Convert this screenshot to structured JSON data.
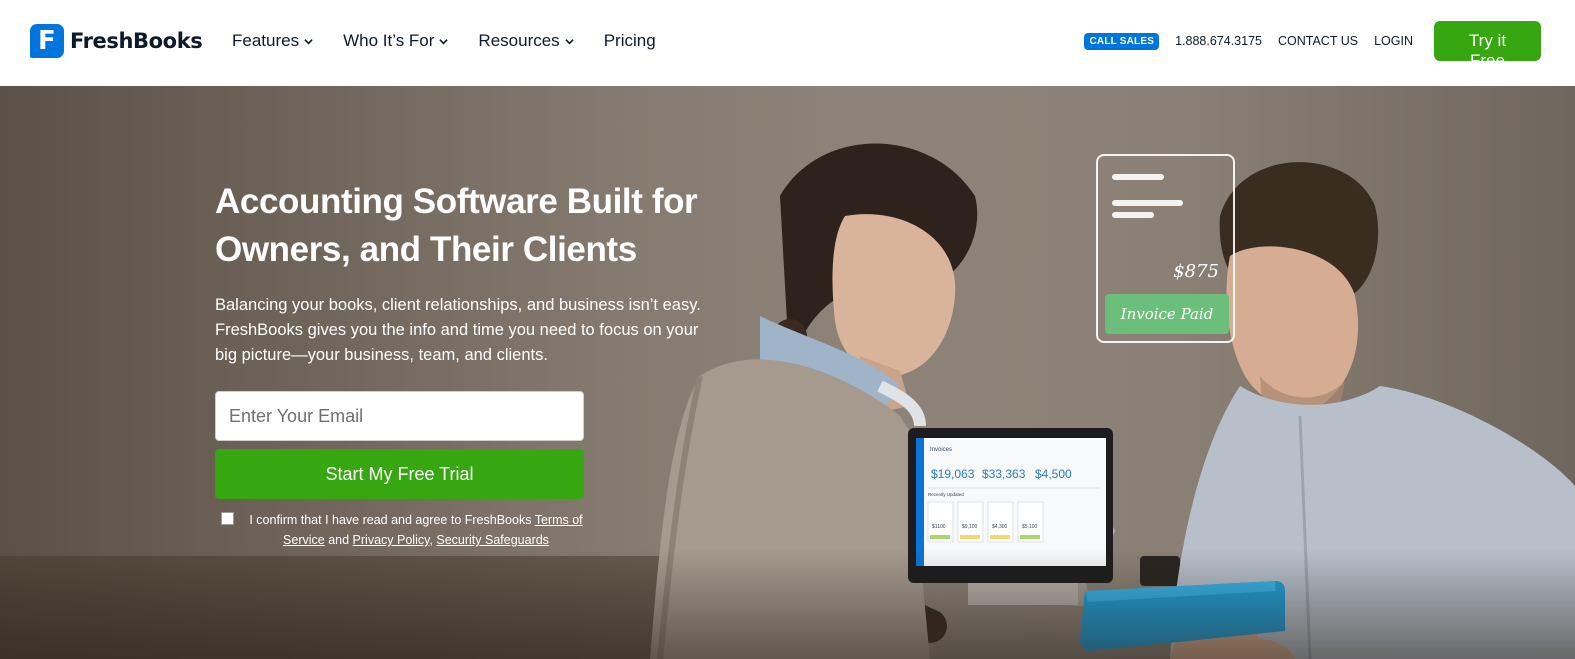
{
  "brand": {
    "name": "FreshBooks",
    "logo_letter": "F"
  },
  "nav": {
    "items": [
      {
        "label": "Features",
        "has_dropdown": true
      },
      {
        "label": "Who It’s For",
        "has_dropdown": true
      },
      {
        "label": "Resources",
        "has_dropdown": true
      },
      {
        "label": "Pricing",
        "has_dropdown": false
      }
    ]
  },
  "header_right": {
    "call_sales": "CALL SALES",
    "phone": "1.888.674.3175",
    "contact": "CONTACT US",
    "login": "LOGIN",
    "try_free": "Try it Free"
  },
  "hero": {
    "title": "Accounting Software Built for Owners, and Their Clients",
    "subtitle": "Balancing your books, client relationships, and business isn’t easy. FreshBooks gives you the info and time you need to focus on your big picture—your business, team, and clients.",
    "email_placeholder": "Enter Your Email",
    "cta": "Start My Free Trial",
    "consent": {
      "prefix": "I confirm that I have read and agree to FreshBooks ",
      "terms": "Terms of Service",
      "and": " and ",
      "privacy": "Privacy Policy",
      "comma": ", ",
      "security": "Security Safeguards",
      "checked": false
    }
  },
  "invoice_card": {
    "amount": "$875",
    "status": "Invoice Paid"
  },
  "laptop_screen": {
    "title": "Invoices",
    "stats": [
      "$19,063",
      "$33,363",
      "$4,500"
    ],
    "section": "Recently Updated",
    "card_amounts": [
      "$1100",
      "$9,100",
      "$4,300",
      "$5,100"
    ]
  },
  "colors": {
    "brand_blue": "#0075dd",
    "cta_green": "#37a711",
    "text_dark": "#0d1a2b",
    "badge_green": "#6cbf7a"
  }
}
